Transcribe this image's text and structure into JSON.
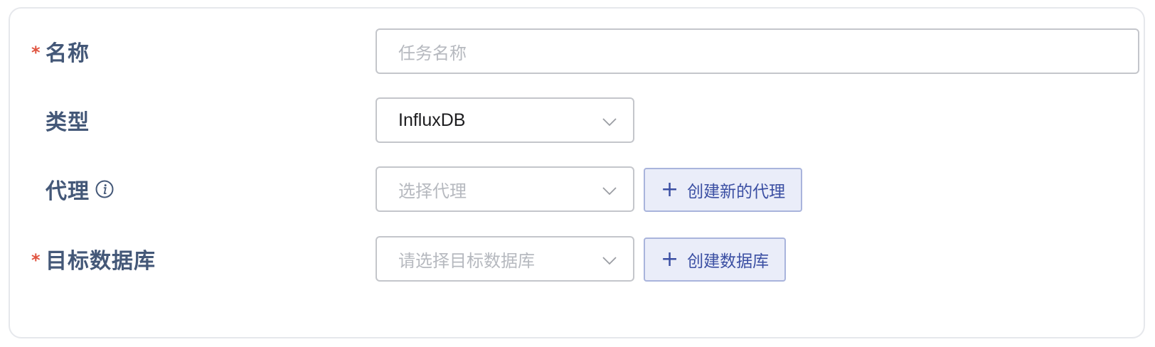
{
  "form": {
    "name": {
      "required_mark": "*",
      "label": "名称",
      "placeholder": "任务名称",
      "value": ""
    },
    "type": {
      "label": "类型",
      "value": "InfluxDB"
    },
    "proxy": {
      "label": "代理",
      "placeholder": "选择代理",
      "create_button": "创建新的代理",
      "info_icon": "info-icon"
    },
    "target_db": {
      "required_mark": "*",
      "label": "目标数据库",
      "placeholder": "请选择目标数据库",
      "create_button": "创建数据库"
    }
  },
  "icons": {
    "plus": "+",
    "chevron": "chevron-down-icon"
  },
  "colors": {
    "label": "#445878",
    "required": "#e0533f",
    "button_bg": "#eaedf9",
    "button_border": "#a9b4dc",
    "button_text": "#3b4fa3",
    "placeholder": "#b6b9bf"
  }
}
